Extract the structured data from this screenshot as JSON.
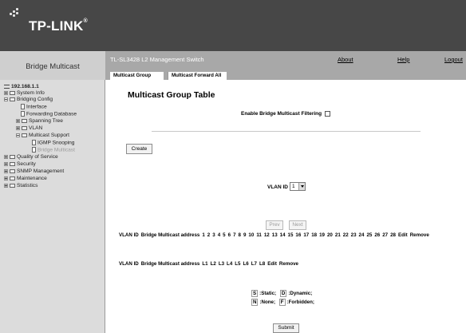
{
  "brand": {
    "name": "TP-LINK",
    "reg_mark": "®"
  },
  "sidebar_title": "Bridge Multicast",
  "header": {
    "product": "TL-SL3428 L2 Management Switch",
    "nav": {
      "about": "About",
      "help": "Help",
      "logout": "Logout"
    }
  },
  "tabs": [
    {
      "label": "Multicast Group",
      "active": true
    },
    {
      "label": "Multicast Forward All",
      "active": false
    }
  ],
  "tree": [
    {
      "label": "192.168.1.1",
      "type": "root",
      "expander": "minus"
    },
    {
      "label": "System Info",
      "type": "folder",
      "expander": "plus"
    },
    {
      "label": "Bridging Config",
      "type": "folder",
      "expander": "minus"
    },
    {
      "label": "Interface",
      "type": "page"
    },
    {
      "label": "Forwarding Database",
      "type": "page"
    },
    {
      "label": "Spanning Tree",
      "type": "folder",
      "expander": "plus"
    },
    {
      "label": "VLAN",
      "type": "folder",
      "expander": "plus"
    },
    {
      "label": "Multicast Support",
      "type": "folder",
      "expander": "minus"
    },
    {
      "label": "IGMP Snooping",
      "type": "page"
    },
    {
      "label": "Bridge Multicast",
      "type": "page",
      "selected": true
    },
    {
      "label": "Quality of Service",
      "type": "folder",
      "expander": "plus"
    },
    {
      "label": "Security",
      "type": "folder",
      "expander": "plus"
    },
    {
      "label": "SNMP Management",
      "type": "folder",
      "expander": "plus"
    },
    {
      "label": "Maintenance",
      "type": "folder",
      "expander": "plus"
    },
    {
      "label": "Statistics",
      "type": "folder",
      "expander": "plus"
    }
  ],
  "main": {
    "title": "Multicast Group Table",
    "filter_label": "Enable Bridge Multicast Filtering",
    "filter_checked": false,
    "create_label": "Create",
    "vlan_label": "VLAN ID",
    "vlan_value": "1",
    "prev_label": "Prev",
    "next_label": "Next",
    "ports_header": [
      "VLAN ID",
      "Bridge Multicast address",
      "1",
      "2",
      "3",
      "4",
      "5",
      "6",
      "7",
      "8",
      "9",
      "10",
      "11",
      "12",
      "13",
      "14",
      "15",
      "16",
      "17",
      "18",
      "19",
      "20",
      "21",
      "22",
      "23",
      "24",
      "25",
      "26",
      "27",
      "28",
      "Edit",
      "Remove"
    ],
    "lag_header": [
      "VLAN ID",
      "Bridge Multicast address",
      "L1",
      "L2",
      "L3",
      "L4",
      "L5",
      "L6",
      "L7",
      "L8",
      "Edit",
      "Remove"
    ],
    "legend": {
      "s_key": "S",
      "s_text": ":Static;",
      "d_key": "D",
      "d_text": ":Dynamic;",
      "n_key": "N",
      "n_text": ":None;",
      "f_key": "F",
      "f_text": ":Forbidden;"
    },
    "submit_label": "Submit"
  }
}
